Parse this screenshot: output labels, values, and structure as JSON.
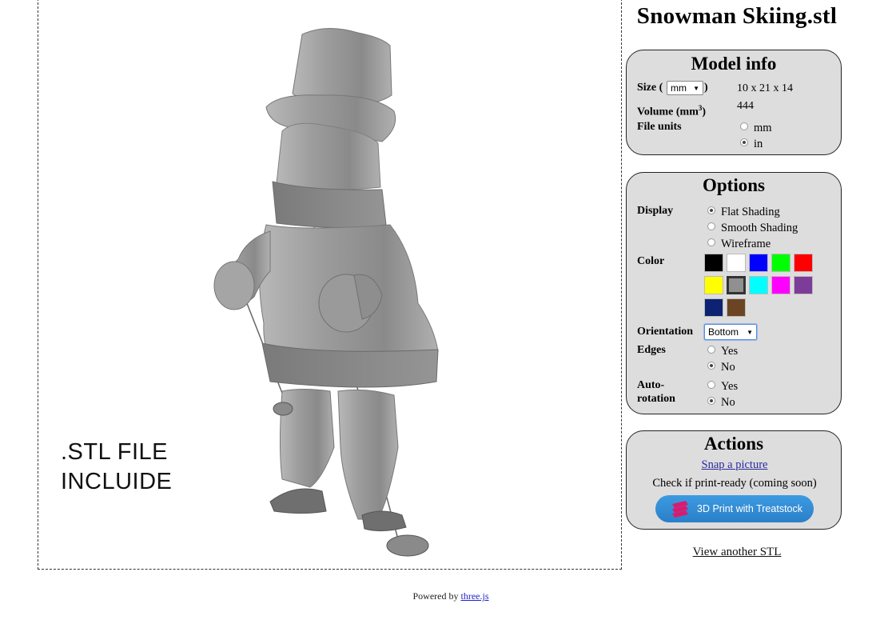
{
  "file_title": "Snowman Skiing.stl",
  "viewer": {
    "overlay_line1": ".STL FILE",
    "overlay_line2": "INCLUIDE",
    "model_color": "#9a9a9a"
  },
  "model_info": {
    "title": "Model info",
    "size_label": "Size (",
    "size_label_close": ")",
    "size_unit": "mm",
    "size_value": "10 x 21 x 14",
    "volume_label": "Volume (mm",
    "volume_sup": "3",
    "volume_close": ")",
    "volume_value": "444",
    "file_units_label": "File units",
    "file_units": [
      {
        "label": "mm",
        "checked": false
      },
      {
        "label": "in",
        "checked": true
      }
    ]
  },
  "options": {
    "title": "Options",
    "display_label": "Display",
    "display_options": [
      {
        "label": "Flat Shading",
        "checked": true
      },
      {
        "label": "Smooth Shading",
        "checked": false
      },
      {
        "label": "Wireframe",
        "checked": false
      }
    ],
    "color_label": "Color",
    "colors": [
      "#000000",
      "#ffffff",
      "#0000ff",
      "#00ff00",
      "#ff0000",
      "#ffff00",
      "#909090",
      "#00ffff",
      "#ff00ff",
      "#7d3c98",
      "#0d2272",
      "#6b4423"
    ],
    "selected_color": "#909090",
    "orientation_label": "Orientation",
    "orientation_value": "Bottom",
    "edges_label": "Edges",
    "edges_options": [
      {
        "label": "Yes",
        "checked": false
      },
      {
        "label": "No",
        "checked": true
      }
    ],
    "autorotation_label_1": "Auto-",
    "autorotation_label_2": "rotation",
    "autorotation_options": [
      {
        "label": "Yes",
        "checked": false
      },
      {
        "label": "No",
        "checked": true
      }
    ]
  },
  "actions": {
    "title": "Actions",
    "snap_label": "Snap a picture",
    "print_ready_text": "Check if print-ready (coming soon)",
    "treatstock_label": "3D Print with Treatstock",
    "treatstock_color": "#2d86d0"
  },
  "view_another_label": "View another STL",
  "footer": {
    "powered_by": "Powered by",
    "lib_label": "three.js"
  }
}
